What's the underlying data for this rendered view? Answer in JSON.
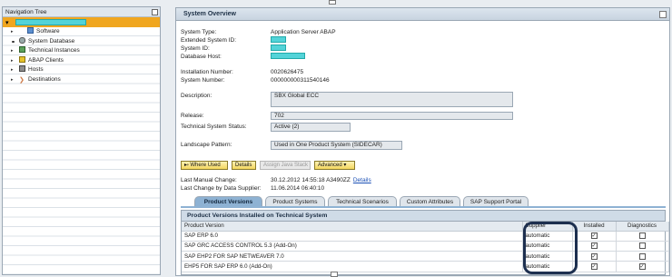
{
  "nav": {
    "header_title": "Navigation Tree",
    "items": [
      {
        "label": "Software",
        "level": 2
      },
      {
        "label": "System Database",
        "level": 1
      },
      {
        "label": "Technical Instances",
        "level": 1
      },
      {
        "label": "ABAP Clients",
        "level": 1
      },
      {
        "label": "Hosts",
        "level": 1
      },
      {
        "label": "Destinations",
        "level": 1
      }
    ]
  },
  "overview": {
    "title": "System Overview",
    "system_type_label": "System Type:",
    "system_type": "Application Server ABAP",
    "ext_system_id_label": "Extended System ID:",
    "system_id_label": "System ID:",
    "db_host_label": "Database Host:",
    "installation_number_label": "Installation Number:",
    "installation_number": "0020626475",
    "system_number_label": "System Number:",
    "system_number": "000000000311540146",
    "description_label": "Description:",
    "description": "SBX Global ECC",
    "release_label": "Release:",
    "release": "702",
    "tech_status_label": "Technical System Status:",
    "tech_status": "Active (2)",
    "landscape_label": "Landscape Pattern:",
    "landscape": "Used in One Product System (SIDECAR)"
  },
  "buttons": {
    "where_used": "▸⬫ Where Used",
    "details": "Details",
    "assign_java": "Assign Java Stack",
    "advanced": "Advanced ▾"
  },
  "changes": {
    "manual_label": "Last Manual Change:",
    "manual_value": "30.12.2012 14:55:18 A3490ZZ",
    "details_link": "Details",
    "supplier_label": "Last Change by Data Supplier:",
    "supplier_value": "11.06.2014 06:40:10"
  },
  "tabs": [
    "Product Versions",
    "Product Systems",
    "Technical Scenarios",
    "Custom Attributes",
    "SAP Support Portal"
  ],
  "table": {
    "title": "Product Versions Installed on Technical System",
    "columns": [
      "Product Version",
      "Supplier",
      "Installed",
      "Diagnostics"
    ],
    "rows": [
      {
        "product": "SAP ERP 6.0",
        "supplier": "automatic",
        "installed": true,
        "diagnostics": false
      },
      {
        "product": "SAP GRC ACCESS CONTROL 5.3 (Add-On)",
        "supplier": "automatic",
        "installed": true,
        "diagnostics": false
      },
      {
        "product": "SAP EHP2 FOR SAP NETWEAVER 7.0",
        "supplier": "automatic",
        "installed": true,
        "diagnostics": false
      },
      {
        "product": "EHP5 FOR SAP ERP 6.0 (Add-On)",
        "supplier": "automatic",
        "installed": true,
        "diagnostics": true
      }
    ]
  }
}
